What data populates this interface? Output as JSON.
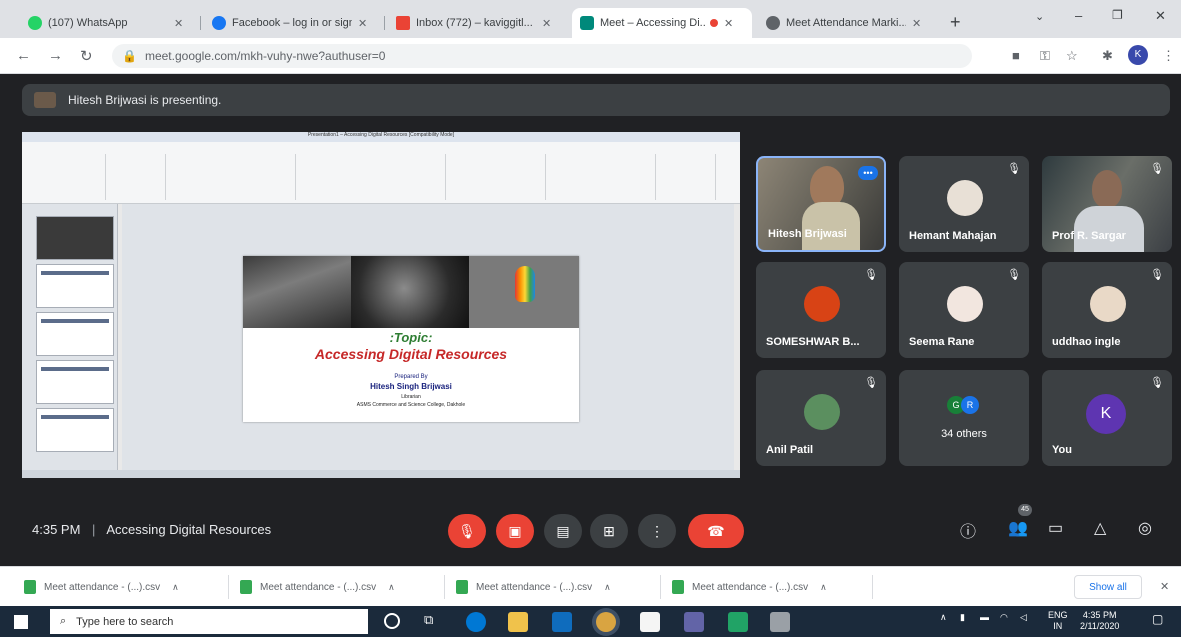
{
  "browser": {
    "tabs": [
      {
        "title": "(107) WhatsApp",
        "icon": "whatsapp-icon",
        "color": "#25d366"
      },
      {
        "title": "Facebook – log in or sign up",
        "icon": "facebook-icon",
        "color": "#1877f2"
      },
      {
        "title": "Inbox (772) – kaviggitl...",
        "icon": "gmail-icon",
        "color": "#ea4335"
      },
      {
        "title": "Meet – Accessing Di...",
        "icon": "meet-icon",
        "color": "#00897b"
      },
      {
        "title": "Meet Attendance Marki...",
        "icon": "extension-icon",
        "color": "#5f6368"
      }
    ],
    "new_tab_label": "+",
    "url": "meet.google.com/mkh-vuhy-nwe?authuser=0",
    "profile_initial": "K"
  },
  "meet": {
    "banner_text": "Hitesh Brijwasi is presenting.",
    "slide": {
      "topic": ":Topic:",
      "title": "Accessing Digital Resources",
      "prepared_by": "Prepared By",
      "presenter": "Hitesh Singh Brijwasi",
      "role": "Librarian",
      "institution": "ASMS Commerce and Science College, Dakhole"
    },
    "ppt_title": "Presentation1 – Accessing Digital Resources [Compatibility Mode]",
    "participants": [
      {
        "name": "Hitesh Brijwasi"
      },
      {
        "name": "Hemant Mahajan"
      },
      {
        "name": "Prof R. Sargar"
      },
      {
        "name": "SOMESHWAR B..."
      },
      {
        "name": "Seema Rane"
      },
      {
        "name": "uddhao ingle"
      },
      {
        "name": "Anil Patil"
      },
      {
        "name": "34 others",
        "initials": [
          "G",
          "R"
        ]
      },
      {
        "name": "You",
        "initial": "K"
      }
    ],
    "clock": "4:35 PM",
    "separator": "|",
    "meeting_title": "Accessing Digital Resources",
    "participant_count": "45",
    "speaking_badge": "•••"
  },
  "downloads": {
    "items": [
      "Meet attendance - (...).csv",
      "Meet attendance - (...).csv",
      "Meet attendance - (...).csv",
      "Meet attendance - (...).csv"
    ],
    "show_all": "Show all",
    "close": "✕"
  },
  "taskbar": {
    "search_placeholder": "Type here to search",
    "lang": "ENG",
    "region": "IN",
    "time": "4:35 PM",
    "date": "2/11/2020"
  }
}
